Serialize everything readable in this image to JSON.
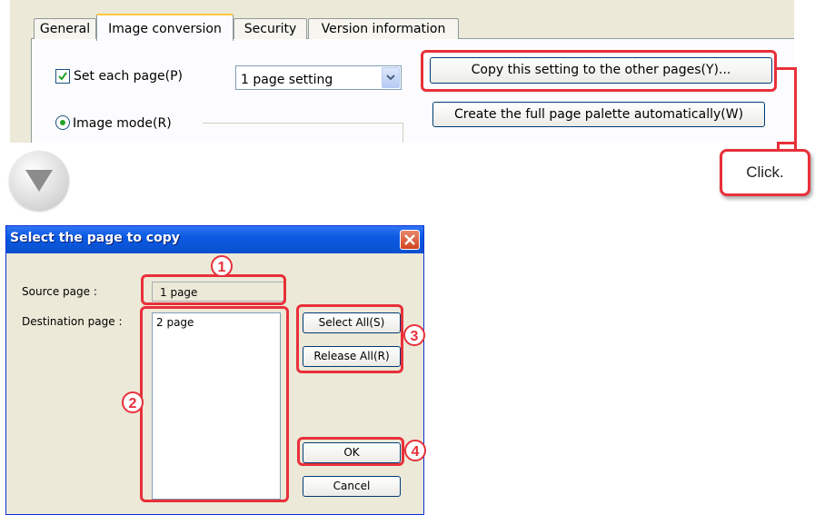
{
  "top_panel": {
    "tabs": [
      "General",
      "Image conversion",
      "Security",
      "Version information"
    ],
    "active_tab": "Image conversion",
    "set_each_page_label": "Set each page(P)",
    "set_each_page_checked": true,
    "page_setting_value": "1 page setting",
    "copy_button_label": "Copy this setting to the other pages(Y)...",
    "palette_button_label": "Create the full page palette automatically(W)",
    "image_mode_label": "Image mode(R)"
  },
  "callout": {
    "click_label": "Click."
  },
  "arrow_icon": "down-triangle-icon",
  "dialog": {
    "title": "Select the page to copy",
    "source_label": "Source page :",
    "source_value": "1 page",
    "destination_label": "Destination page :",
    "destination_items": [
      "2 page"
    ],
    "select_all_label": "Select All(S)",
    "release_all_label": "Release All(R)",
    "ok_label": "OK",
    "cancel_label": "Cancel"
  },
  "markers": [
    "1",
    "2",
    "3",
    "4"
  ],
  "colors": {
    "callout_red": "#e8303a",
    "titlebar_blue": "#0b5ae2",
    "dialog_bg": "#ece9d8"
  }
}
